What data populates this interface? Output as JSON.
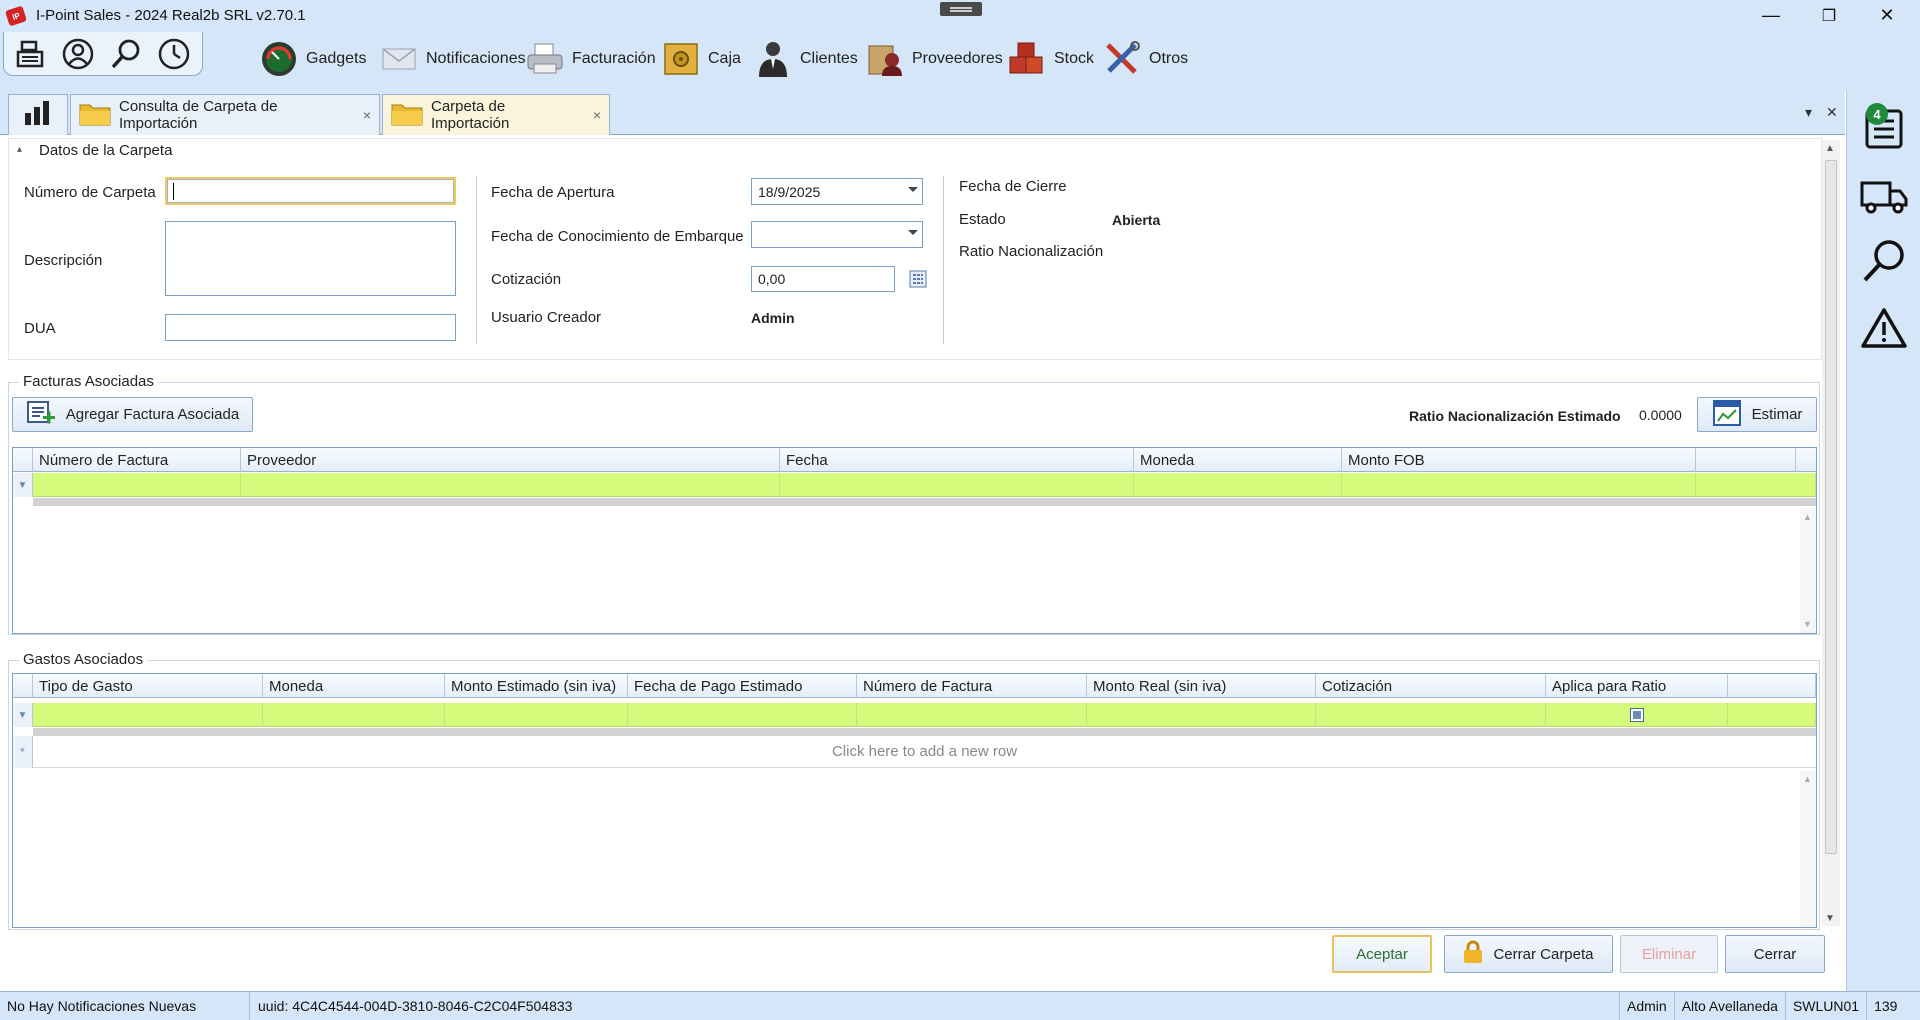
{
  "window": {
    "title": "I-Point Sales  - 2024 Real2b SRL v2.70.1",
    "minimize": "—",
    "restore": "❐",
    "close": "✕"
  },
  "menu": {
    "items": [
      {
        "label": "Gadgets"
      },
      {
        "label": "Notificaciones"
      },
      {
        "label": "Facturación"
      },
      {
        "label": "Caja"
      },
      {
        "label": "Clientes"
      },
      {
        "label": "Proveedores"
      },
      {
        "label": "Stock"
      },
      {
        "label": "Otros"
      }
    ]
  },
  "tabs": [
    {
      "label": "Consulta de Carpeta de Importación",
      "close": "×"
    },
    {
      "label": "Carpeta de Importación",
      "close": "×"
    }
  ],
  "tabstrip": {
    "dropdown": "▾",
    "close": "✕"
  },
  "dock": {
    "badge": "4"
  },
  "datos": {
    "title": "Datos de la Carpeta",
    "collapse": "▴",
    "numero_label": "Número de Carpeta",
    "numero_value": "",
    "descripcion_label": "Descripción",
    "descripcion_value": "",
    "dua_label": "DUA",
    "dua_value": "",
    "apertura_label": "Fecha de Apertura",
    "apertura_value": "18/9/2025",
    "conocimiento_label": "Fecha de Conocimiento de Embarque",
    "conocimiento_value": "",
    "cotizacion_label": "Cotización",
    "cotizacion_value": "0,00",
    "usuario_label": "Usuario Creador",
    "usuario_value": "Admin",
    "cierre_label": "Fecha de Cierre",
    "estado_label": "Estado",
    "estado_value": "Abierta",
    "ratio_label": "Ratio Nacionalización"
  },
  "facturas": {
    "title": "Facturas Asociadas",
    "add_button": "Agregar Factura Asociada",
    "ratio_label": "Ratio Nacionalización Estimado",
    "ratio_value": "0.0000",
    "estimar_button": "Estimar",
    "columns": [
      "Número de Factura",
      "Proveedor",
      "Fecha",
      "Moneda",
      "Monto FOB"
    ]
  },
  "gastos": {
    "title": "Gastos Asociados",
    "columns": [
      "Tipo de Gasto",
      "Moneda",
      "Monto Estimado (sin iva)",
      "Fecha de Pago Estimado",
      "Número de Factura",
      "Monto Real (sin iva)",
      "Cotización",
      "Aplica para Ratio"
    ],
    "new_row": "Click here to add a new row"
  },
  "actions": {
    "aceptar": "Aceptar",
    "cerrar_carpeta": "Cerrar Carpeta",
    "eliminar": "Eliminar",
    "cerrar": "Cerrar"
  },
  "status": {
    "notifications": "No Hay Notificaciones Nuevas",
    "uuid": "uuid: 4C4C4544-004D-3810-8046-C2C04F504833",
    "user": "Admin",
    "branch": "Alto Avellaneda",
    "machine": "SWLUN01",
    "code": "139"
  },
  "colors": {
    "chrome": "#d6e6f9",
    "filter_row": "#d4fb7c",
    "badge": "#1f8a3a",
    "accept_text": "#2c6e2c"
  }
}
